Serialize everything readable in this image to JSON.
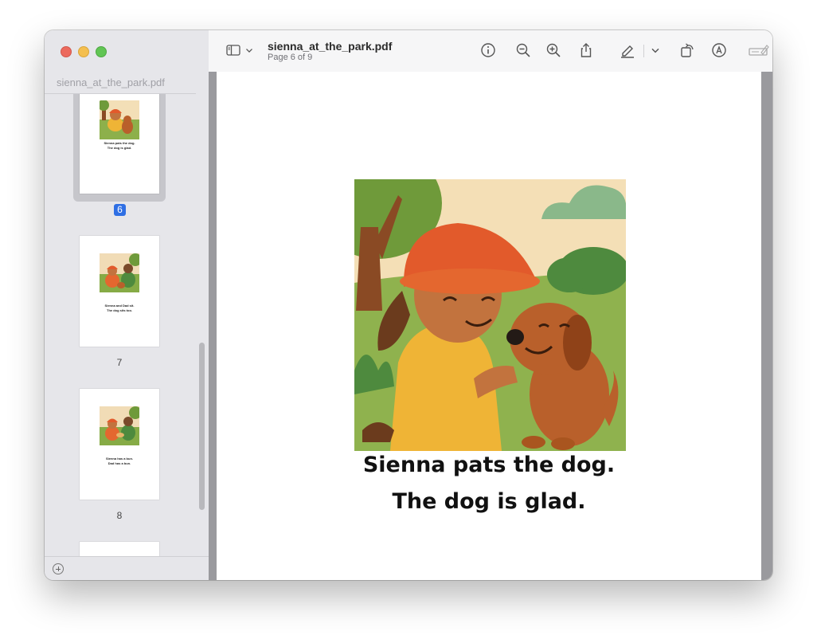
{
  "window": {
    "sidebar_title": "sienna_at_the_park.pdf",
    "doc_title": "sienna_at_the_park.pdf",
    "page_indicator": "Page 6 of 9"
  },
  "sidebar": {
    "thumbnails": [
      {
        "page": "6",
        "selected": true,
        "line1": "Sienna pats the dog.",
        "line2": "The dog is glad."
      },
      {
        "page": "7",
        "selected": false,
        "line1": "Sienna and Dad sit.",
        "line2": "The dog sits too."
      },
      {
        "page": "8",
        "selected": false,
        "line1": "Sienna has a bun.",
        "line2": "Dad has a bun."
      }
    ]
  },
  "toolbar": {
    "icons": [
      "sidebar-toggle-icon",
      "chevron-down-icon",
      "info-icon",
      "zoom-out-icon",
      "zoom-in-icon",
      "share-icon",
      "highlight-pen-icon",
      "chevron-down-icon",
      "rotate-icon",
      "markup-icon",
      "form-fill-icon",
      "search-icon"
    ]
  },
  "page": {
    "caption_line1": "Sienna pats the dog.",
    "caption_line2": "The dog is glad."
  },
  "colors": {
    "accent": "#2f6fe4",
    "sidebar_bg": "#e6e6ea",
    "toolbar_bg": "#f6f6f7"
  }
}
